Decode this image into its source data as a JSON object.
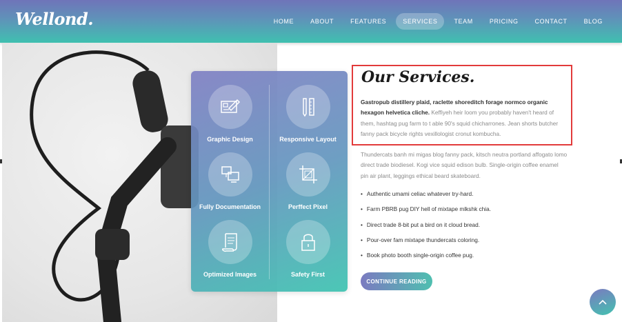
{
  "brand": {
    "logo_text": "Wellond."
  },
  "nav": {
    "items": [
      {
        "label": "HOME"
      },
      {
        "label": "ABOUT"
      },
      {
        "label": "FEATURES"
      },
      {
        "label": "SERVICES",
        "active": true
      },
      {
        "label": "TEAM"
      },
      {
        "label": "PRICING"
      },
      {
        "label": "CONTACT"
      },
      {
        "label": "BLOG"
      }
    ]
  },
  "features": [
    {
      "label": "Graphic Design",
      "icon": "graphic-design-icon"
    },
    {
      "label": "Responsive Layout",
      "icon": "responsive-layout-icon"
    },
    {
      "label": "Fully Documentation",
      "icon": "documentation-icon"
    },
    {
      "label": "Perffect Pixel",
      "icon": "pixel-crop-icon"
    },
    {
      "label": "Optimized Images",
      "icon": "optimized-images-icon"
    },
    {
      "label": "Safety First",
      "icon": "padlock-icon"
    }
  ],
  "services": {
    "title": "Our Services.",
    "intro_bold": "Gastropub distillery plaid, raclette shoreditch forage normco organic hexagon helvetica cliche.",
    "intro_rest": "Keffiyeh heir loom you probably haven't heard of them, hashtag pug farm to t able 90's squid chicharrones. Jean shorts butcher fanny pack bicycle rights vexillologist cronut kombucha.",
    "paragraph": "Thundercats banh mi migas blog fanny pack, kitsch neutra portland affogato lomo direct trade biodiesel. Kogi vice squid edison bulb. Single-origin coffee enamel pin air plant, leggings ethical beard skateboard.",
    "bullets": [
      "Authentic umami celiac whatever try-hard.",
      "Farm PBRB pug DIY hell of mixtape mlkshk chia.",
      "Direct trade 8-bit put a bird on it cloud bread.",
      "Pour-over fam mixtape thundercats coloring.",
      "Book photo booth single-origin coffee pug."
    ],
    "button_label": "CONTINUE READING"
  },
  "colors": {
    "gradient_start": "#7b7ac0",
    "gradient_end": "#43c2b0",
    "highlight_border": "#e23a3a"
  }
}
